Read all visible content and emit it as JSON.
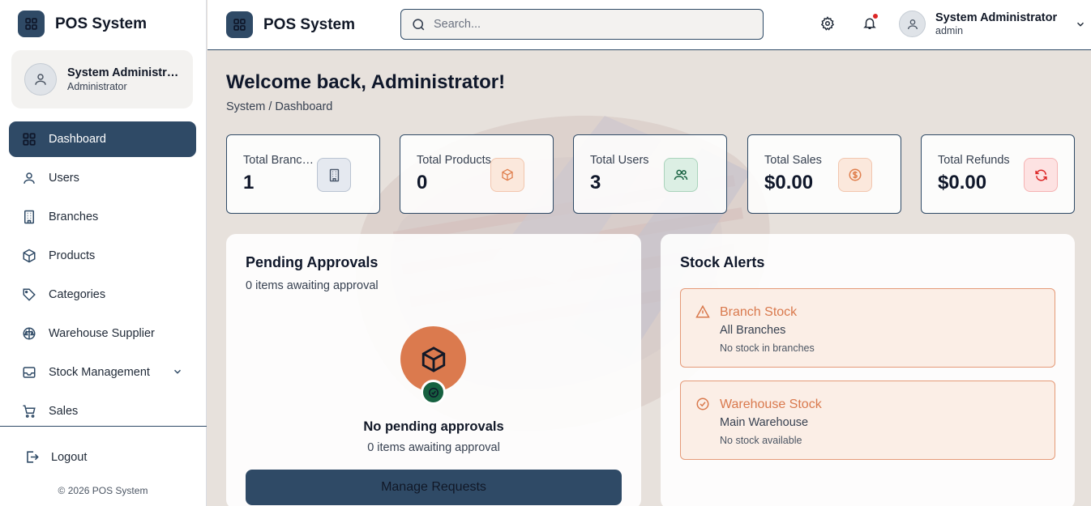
{
  "app": {
    "title": "POS System"
  },
  "sidebar": {
    "user": {
      "name": "System Administrator",
      "role": "Administrator"
    },
    "items": [
      {
        "label": "Dashboard",
        "icon": "dashboard-grid-icon",
        "active": true
      },
      {
        "label": "Users",
        "icon": "user-icon"
      },
      {
        "label": "Branches",
        "icon": "building-icon"
      },
      {
        "label": "Products",
        "icon": "box-icon"
      },
      {
        "label": "Categories",
        "icon": "tag-icon"
      },
      {
        "label": "Warehouse Supplier",
        "icon": "warehouse-icon"
      },
      {
        "label": "Stock Management",
        "icon": "inbox-icon",
        "expandable": true
      },
      {
        "label": "Sales",
        "icon": "cart-icon"
      }
    ],
    "logout": "Logout",
    "copyright": "© 2026 POS System"
  },
  "header": {
    "title": "POS System",
    "search_placeholder": "Search...",
    "user": {
      "name": "System Administrator",
      "role": "admin"
    }
  },
  "main": {
    "welcome": "Welcome back, Administrator!",
    "breadcrumb": "System / Dashboard",
    "stats": [
      {
        "label": "Total Branches",
        "value": "1",
        "icon": "building-icon",
        "color": "#475569",
        "bg": "#e5e9f0"
      },
      {
        "label": "Total Products",
        "value": "0",
        "icon": "box-icon",
        "color": "#e0804f",
        "bg": "#fbe8dc"
      },
      {
        "label": "Total Users",
        "value": "3",
        "icon": "users-icon",
        "color": "#166140",
        "bg": "#dcefe4"
      },
      {
        "label": "Total Sales",
        "value": "$0.00",
        "icon": "dollar-icon",
        "color": "#e0804f",
        "bg": "#fbe8dc"
      },
      {
        "label": "Total Refunds",
        "value": "$0.00",
        "icon": "refresh-icon",
        "color": "#dc2626",
        "bg": "#fde2e2"
      }
    ],
    "pending": {
      "title": "Pending Approvals",
      "subtitle": "0 items awaiting approval",
      "empty_title": "No pending approvals",
      "empty_subtitle": "0 items awaiting approval",
      "button": "Manage Requests"
    },
    "stock": {
      "title": "Stock Alerts",
      "alerts": [
        {
          "title": "Branch Stock",
          "location": "All Branches",
          "message": "No stock in branches",
          "icon": "warning-icon"
        },
        {
          "title": "Warehouse Stock",
          "location": "Main Warehouse",
          "message": "No stock available",
          "icon": "check-circle-icon"
        }
      ]
    }
  },
  "colors": {
    "primary": "#2f4a66",
    "accent": "#db7a4e",
    "success": "#166140",
    "danger": "#dc2626"
  }
}
